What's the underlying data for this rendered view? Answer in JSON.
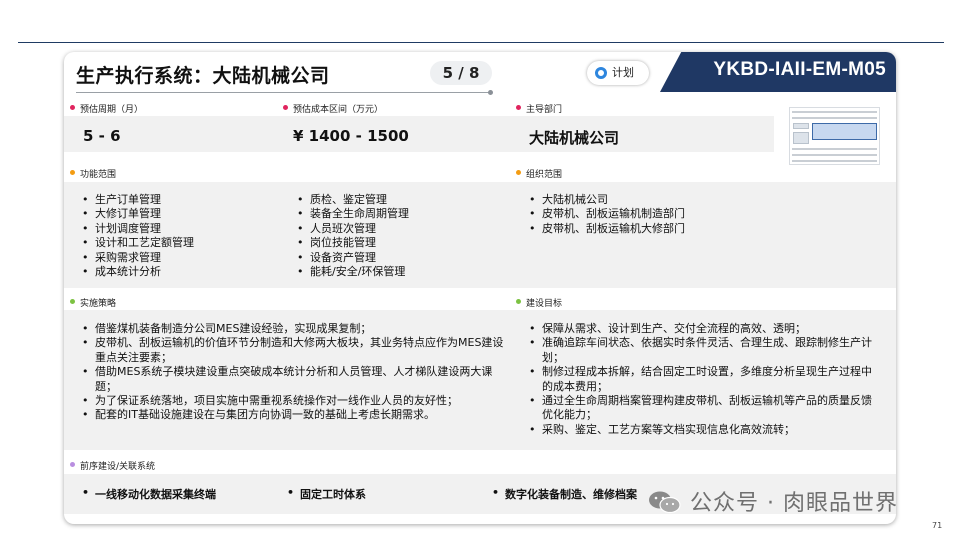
{
  "header": {
    "title": "生产执行系统：大陆机械公司",
    "page_indicator": "5 / 8",
    "status_label": "计划",
    "project_code": "YKBD-IAII-EM-M05"
  },
  "fields": {
    "period": {
      "label": "预估周期（月）",
      "value": "5 - 6"
    },
    "cost": {
      "label": "预估成本区间（万元）",
      "value": "¥ 1400 - 1500"
    },
    "department": {
      "label": "主导部门",
      "value": "大陆机械公司"
    }
  },
  "scope": {
    "label": "功能范围",
    "col1": [
      "生产订单管理",
      "大修订单管理",
      "计划调度管理",
      "设计和工艺定额管理",
      "采购需求管理",
      "成本统计分析"
    ],
    "col2": [
      "质检、鉴定管理",
      "装备全生命周期管理",
      "人员班次管理",
      "岗位技能管理",
      "设备资产管理",
      "能耗/安全/环保管理"
    ]
  },
  "org": {
    "label": "组织范围",
    "items": [
      "大陆机械公司",
      "皮带机、刮板运输机制造部门",
      "皮带机、刮板运输机大修部门"
    ]
  },
  "strategy": {
    "label": "实施策略",
    "items": [
      "借鉴煤机装备制造分公司MES建设经验，实现成果复制；",
      "皮带机、刮板运输机的价值环节分制造和大修两大板块，其业务特点应作为MES建设重点关注要素；",
      "借助MES系统子模块建设重点突破成本统计分析和人员管理、人才梯队建设两大课题；",
      "为了保证系统落地，项目实施中需重视系统操作对一线作业人员的友好性；",
      "配套的IT基础设施建设在与集团方向协调一致的基础上考虑长期需求。"
    ]
  },
  "goals": {
    "label": "建设目标",
    "items": [
      "保障从需求、设计到生产、交付全流程的高效、透明；",
      "准确追踪车间状态、依据实时条件灵活、合理生成、跟踪制修生产计划；",
      "制修过程成本拆解，结合固定工时设置，多维度分析呈现生产过程中的成本费用；",
      "通过全生命周期档案管理构建皮带机、刮板运输机等产品的质量反馈优化能力；",
      "采购、鉴定、工艺方案等文档实现信息化高效流转；"
    ]
  },
  "related": {
    "label": "前序建设/关联系统",
    "items": [
      "一线移动化数据采集终端",
      "固定工时体系",
      "数字化装备制造、维修档案"
    ]
  },
  "watermark": "公众号 · 肉眼品世界",
  "page_number": "71",
  "colors": {
    "navy": "#1f3864",
    "dot_red": "#e0245e",
    "dot_orange": "#f39c12",
    "dot_green": "#7cc242",
    "dot_purple": "#b98ee0",
    "status_blue": "#2e86de"
  }
}
